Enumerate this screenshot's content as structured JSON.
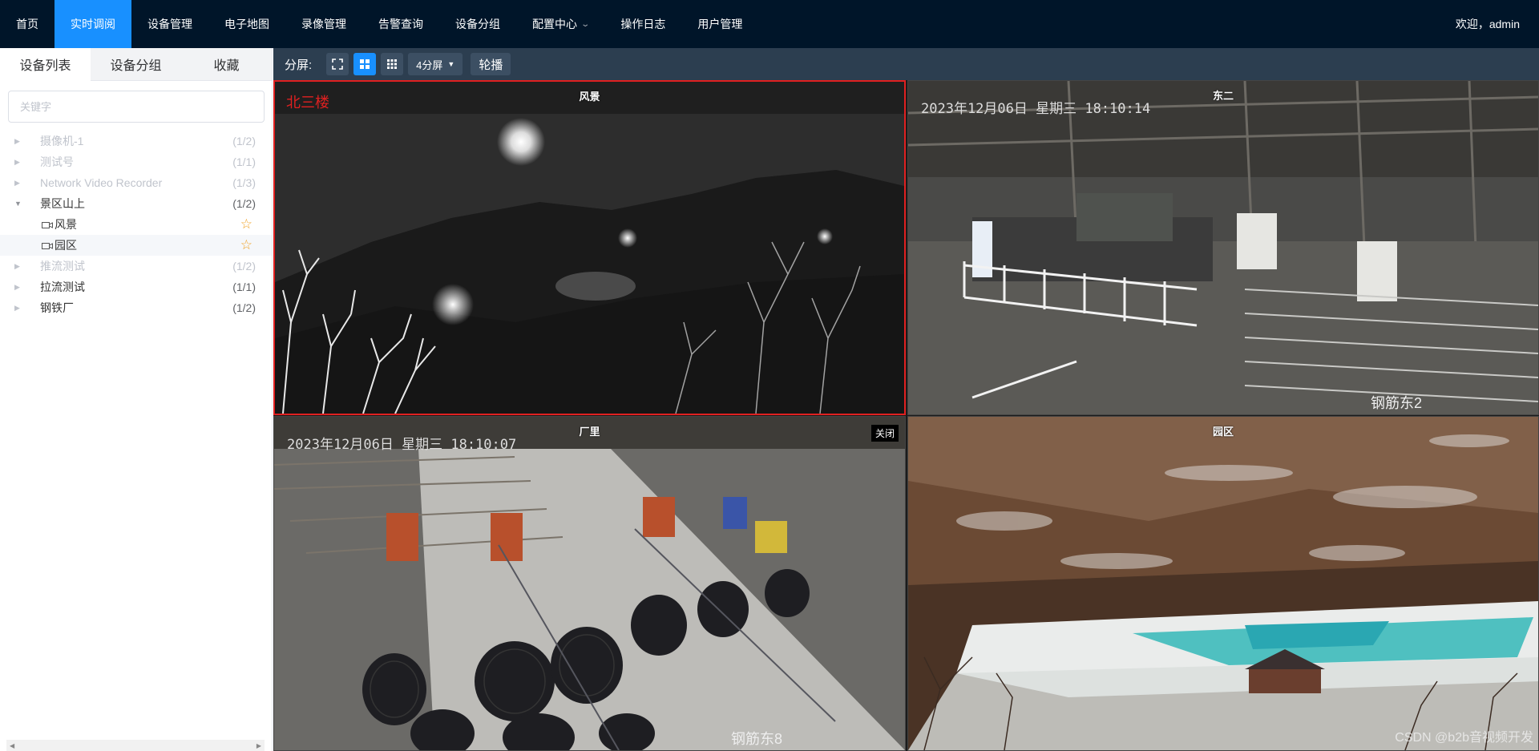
{
  "nav": {
    "items": [
      {
        "label": "首页"
      },
      {
        "label": "实时调阅"
      },
      {
        "label": "设备管理"
      },
      {
        "label": "电子地图"
      },
      {
        "label": "录像管理"
      },
      {
        "label": "告警查询"
      },
      {
        "label": "设备分组"
      },
      {
        "label": "配置中心"
      },
      {
        "label": "操作日志"
      },
      {
        "label": "用户管理"
      }
    ],
    "active_index": 1,
    "welcome": "欢迎，admin"
  },
  "sidebar": {
    "tabs": [
      "设备列表",
      "设备分组",
      "收藏"
    ],
    "active_tab": 0,
    "search_placeholder": "关键字",
    "tree": [
      {
        "label": "摄像机-1",
        "count": "(1/2)",
        "disabled": true
      },
      {
        "label": "测试号",
        "count": "(1/1)",
        "disabled": true
      },
      {
        "label": "Network Video Recorder",
        "count": "(1/3)",
        "disabled": true
      },
      {
        "label": "景区山上",
        "count": "(1/2)",
        "disabled": false,
        "expanded": true,
        "children": [
          {
            "label": "风景",
            "favorite": true
          },
          {
            "label": "园区",
            "favorite": true,
            "selected": true
          }
        ]
      },
      {
        "label": "推流测试",
        "count": "(1/2)",
        "disabled": true
      },
      {
        "label": "拉流测试",
        "count": "(1/1)",
        "disabled": false
      },
      {
        "label": "钢铁厂",
        "count": "(1/2)",
        "disabled": false
      }
    ]
  },
  "toolbar": {
    "split_label": "分屏:",
    "split_select": "4分屏",
    "carousel_label": "轮播",
    "active_layout": "four"
  },
  "videos": [
    {
      "title": "风景",
      "osd_name": "北三楼",
      "selected": true
    },
    {
      "title": "东二",
      "osd_time": "2023年12月06日 星期三 18:10:14",
      "osd_bottom": "钢筋东2"
    },
    {
      "title": "厂里",
      "osd_time": "2023年12月06日 星期三 18:10:07",
      "osd_bottom": "钢筋东8",
      "close_label": "关闭"
    },
    {
      "title": "园区"
    }
  ],
  "watermark": "CSDN @b2b音视频开发",
  "colors": {
    "nav_bg": "#001529",
    "nav_active": "#1890ff",
    "toolbar_bg": "#2c3e50",
    "selected_border": "#e02020",
    "star": "#f0a020"
  }
}
